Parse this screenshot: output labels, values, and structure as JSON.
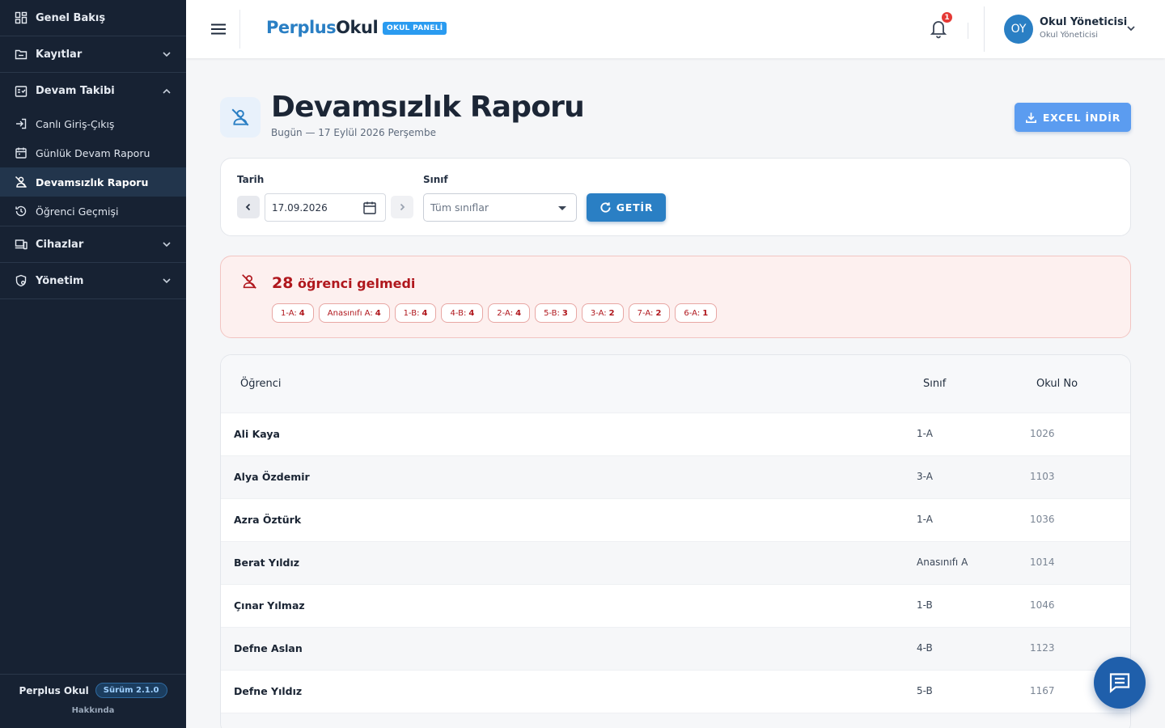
{
  "sidebar": {
    "groups": [
      {
        "label": "Genel Bakış",
        "icon": "dashboard-icon"
      },
      {
        "label": "Kayıtlar",
        "icon": "folder-icon"
      },
      {
        "label": "Devam Takibi",
        "icon": "attendance-icon"
      },
      {
        "label": "Cihazlar",
        "icon": "devices-icon"
      },
      {
        "label": "Yönetim",
        "icon": "admin-icon"
      }
    ],
    "sub_items": [
      {
        "label": "Canlı Giriş-Çıkış",
        "icon": "login-icon"
      },
      {
        "label": "Günlük Devam Raporu",
        "icon": "calendar-icon"
      },
      {
        "label": "Devamsızlık Raporu",
        "icon": "person-off-icon",
        "active": true
      },
      {
        "label": "Öğrenci Geçmişi",
        "icon": "history-icon"
      }
    ],
    "footer": {
      "app_name": "Perplus Okul",
      "version": "Sürüm 2.1.0",
      "about": "Hakkında"
    }
  },
  "topbar": {
    "brand_part1": "Perplus",
    "brand_part2": "Okul",
    "panel_badge": "OKUL PANELİ",
    "notification_count": "1",
    "avatar_initials": "OY",
    "user_name": "Okul Yöneticisi",
    "user_role": "Okul Yöneticisi"
  },
  "page": {
    "title": "Devamsızlık Raporu",
    "subtitle": "Bugün — 17 Eylül 2026 Perşembe",
    "excel_button": "EXCEL İNDİR"
  },
  "filters": {
    "date_label": "Tarih",
    "date_value": "17.09.2026",
    "class_label": "Sınıf",
    "class_value": "Tüm sınıflar",
    "submit_label": "GETİR"
  },
  "summary": {
    "count": "28",
    "text": "öğrenci gelmedi",
    "chips": [
      {
        "label": "1-A:",
        "count": "4"
      },
      {
        "label": "Anasınıfı A:",
        "count": "4"
      },
      {
        "label": "1-B:",
        "count": "4"
      },
      {
        "label": "4-B:",
        "count": "4"
      },
      {
        "label": "2-A:",
        "count": "4"
      },
      {
        "label": "5-B:",
        "count": "3"
      },
      {
        "label": "3-A:",
        "count": "2"
      },
      {
        "label": "7-A:",
        "count": "2"
      },
      {
        "label": "6-A:",
        "count": "1"
      }
    ]
  },
  "table": {
    "headers": {
      "student": "Öğrenci",
      "class": "Sınıf",
      "school_no": "Okul No"
    },
    "rows": [
      {
        "name": "Ali Kaya",
        "class": "1-A",
        "no": "1026"
      },
      {
        "name": "Alya Özdemir",
        "class": "3-A",
        "no": "1103"
      },
      {
        "name": "Azra Öztürk",
        "class": "1-A",
        "no": "1036"
      },
      {
        "name": "Berat Yıldız",
        "class": "Anasınıfı A",
        "no": "1014"
      },
      {
        "name": "Çınar Yılmaz",
        "class": "1-B",
        "no": "1046"
      },
      {
        "name": "Defne Aslan",
        "class": "4-B",
        "no": "1123"
      },
      {
        "name": "Defne Yıldız",
        "class": "5-B",
        "no": "1167"
      },
      {
        "name": "",
        "class": "",
        "no": ""
      }
    ]
  },
  "colors": {
    "sidebar_bg": "#172233",
    "brand_blue": "#2a7fc4",
    "alert_red": "#b0171d",
    "excel_blue": "#5b9cf0"
  }
}
